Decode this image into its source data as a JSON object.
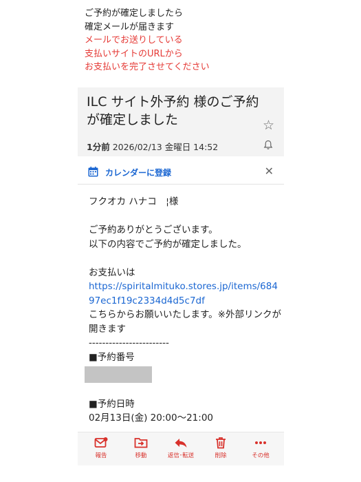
{
  "intro": {
    "line1": "ご予約が確定しましたら",
    "line2": "確定メールが届きます",
    "line3": "メールでお送りしている",
    "line4": "支払いサイトのURLから",
    "line5": "お支払いを完了させてください",
    "colors": {
      "black": "#222222",
      "red": "#e53935"
    }
  },
  "email": {
    "subject": "ILC サイト外予約 様のご予約が確定しました",
    "time_ago": "1分前",
    "date": "2026/02/13 金曜日 14:52",
    "calendar_label": "カレンダーに登録",
    "recipient": "フクオカ ハナコ　¦様",
    "greeting1": "ご予約ありがとうございます。",
    "greeting2": "以下の内容でご予約が確定しました。",
    "payment_intro": "お支払いは",
    "payment_link": "https://spiritalmituko.stores.jp/items/68497ec1f19c2334d4d5c7df",
    "payment_note": "こちらからお願いいたします。※外部リンクが開きます",
    "divider": "------------------------",
    "booking_number_label": "■予約番号",
    "booking_date_label": "■予約日時",
    "booking_date": "02月13日(金) 20:00～21:00"
  },
  "toolbar": {
    "report": "報告",
    "move": "移動",
    "reply": "返信･転送",
    "delete": "削除",
    "more": "その他",
    "accent": "#d8312b"
  }
}
